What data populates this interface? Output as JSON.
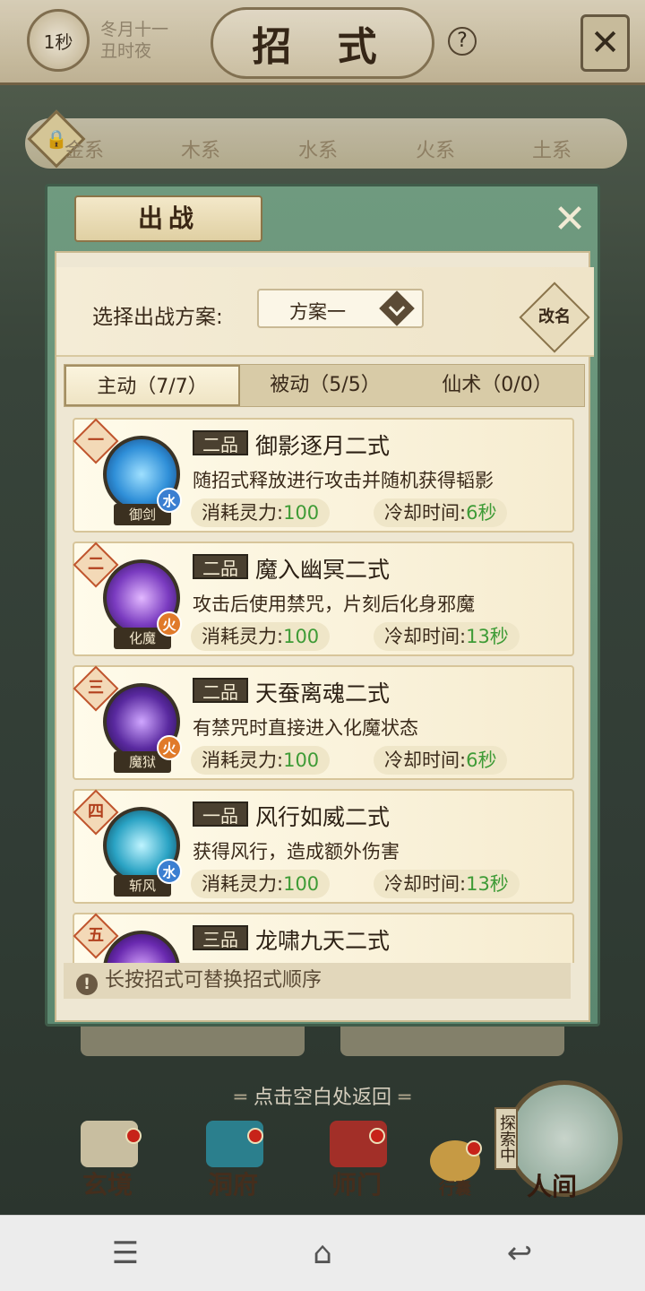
{
  "topbar": {
    "timer": "1秒",
    "date_line1": "冬月十一",
    "date_line2": "丑时夜",
    "title": "招 式",
    "help": "?"
  },
  "element_tabs": [
    "金系",
    "木系",
    "水系",
    "火系",
    "土系"
  ],
  "dialog": {
    "title": "出战",
    "scheme_label": "选择出战方案:",
    "scheme_value": "方案一",
    "rename": "改名",
    "tabs": [
      {
        "label": "主动（7/7）",
        "active": true
      },
      {
        "label": "被动（5/5）",
        "active": false
      },
      {
        "label": "仙术（0/0）",
        "active": false
      }
    ],
    "skills": [
      {
        "rank": "一",
        "grade": "二品",
        "name": "御影逐月二式",
        "desc": "随招式释放进行攻击并随机获得韬影",
        "icon_label": "御剑",
        "element": "水",
        "cost_label": "消耗灵力:",
        "cost": "100",
        "cd_label": "冷却时间:",
        "cd": "6秒",
        "orb_color": "#2f8fd8"
      },
      {
        "rank": "二",
        "grade": "二品",
        "name": "魔入幽冥二式",
        "desc": "攻击后使用禁咒，片刻后化身邪魔",
        "icon_label": "化魔",
        "element": "火",
        "cost_label": "消耗灵力:",
        "cost": "100",
        "cd_label": "冷却时间:",
        "cd": "13秒",
        "orb_color": "#7a3bc0"
      },
      {
        "rank": "三",
        "grade": "二品",
        "name": "天蚕离魂二式",
        "desc": "有禁咒时直接进入化魔状态",
        "icon_label": "魔狱",
        "element": "火",
        "cost_label": "消耗灵力:",
        "cost": "100",
        "cd_label": "冷却时间:",
        "cd": "6秒",
        "orb_color": "#5a2aa0"
      },
      {
        "rank": "四",
        "grade": "一品",
        "name": "风行如威二式",
        "desc": "获得风行，造成额外伤害",
        "icon_label": "斩风",
        "element": "水",
        "cost_label": "消耗灵力:",
        "cost": "100",
        "cd_label": "冷却时间:",
        "cd": "13秒",
        "orb_color": "#2aa3c4"
      },
      {
        "rank": "五",
        "grade": "三品",
        "name": "龙啸九天二式",
        "orb_color": "#6a2ab0"
      }
    ],
    "tip": "长按招式可替换招式顺序"
  },
  "back_hint": "点击空白处返回",
  "bottom_nav": [
    "玄境",
    "洞府",
    "师门",
    "行囊",
    "人间"
  ],
  "explore_tag": "探索中",
  "colors": {
    "accent_green": "#3e9b36",
    "panel_green": "#5b8870",
    "parchment": "#eee7d3",
    "rank_red": "#b2401d"
  }
}
